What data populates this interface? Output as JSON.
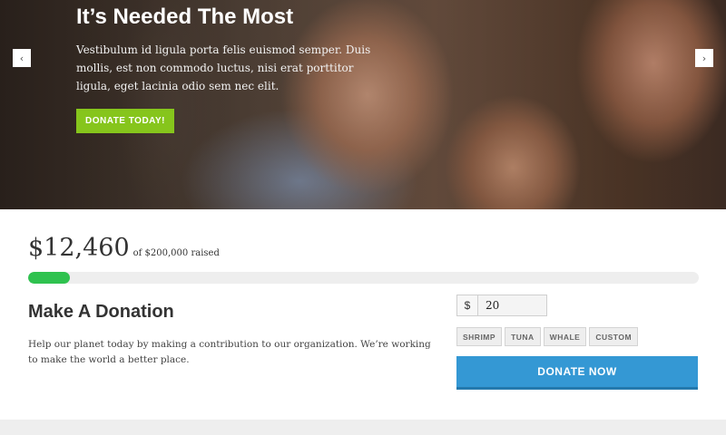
{
  "hero": {
    "title": "It’s Needed The Most",
    "body": "Vestibulum id ligula porta felis euismod semper. Duis mollis, est non commodo luctus, nisi erat porttitor ligula, eget lacinia odio sem nec elit.",
    "cta_label": "DONATE TODAY!",
    "prev_icon": "chevron-left-icon",
    "next_icon": "chevron-right-icon",
    "prev_glyph": "‹",
    "next_glyph": "›"
  },
  "campaign": {
    "raised": "$12,460",
    "goal_text": "of $200,000 raised",
    "progress_fraction": 0.0623,
    "progress_color": "#2fc24f"
  },
  "donation": {
    "title": "Make A Donation",
    "description": "Help our planet today by making a contribution to our organization. We’re working to make the world a better place.",
    "currency": "$",
    "amount": "20",
    "presets": [
      "SHRIMP",
      "TUNA",
      "WHALE",
      "CUSTOM"
    ],
    "submit_label": "DONATE NOW",
    "accent": "#3498d4"
  }
}
